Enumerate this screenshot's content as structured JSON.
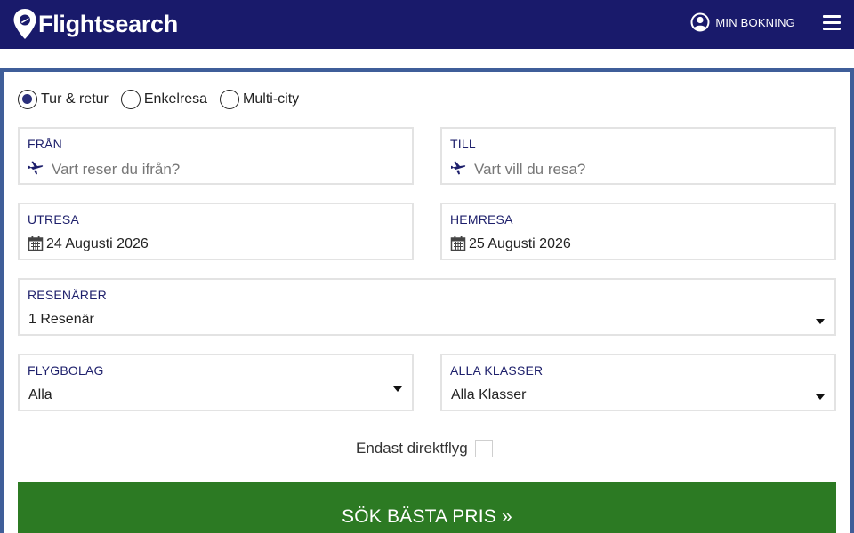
{
  "header": {
    "logo_text": "Flightsearch",
    "my_booking_label": "MIN BOKNING",
    "icons": {
      "logo": "map-pin-icon",
      "account": "user-circle-icon",
      "menu": "hamburger-icon"
    }
  },
  "trip_types": [
    {
      "label": "Tur & retur",
      "selected": true
    },
    {
      "label": "Enkelresa",
      "selected": false
    },
    {
      "label": "Multi-city",
      "selected": false
    }
  ],
  "from": {
    "label": "FRÅN",
    "placeholder": "Vart reser du ifrån?",
    "icon": "airplane-icon"
  },
  "to": {
    "label": "TILL",
    "placeholder": "Vart vill du resa?",
    "icon": "airplane-icon"
  },
  "departure": {
    "label": "UTRESA",
    "value": "24 Augusti 2026",
    "icon": "calendar-icon"
  },
  "return": {
    "label": "HEMRESA",
    "value": "25 Augusti 2026",
    "icon": "calendar-icon"
  },
  "travelers": {
    "label": "RESENÄRER",
    "value": "1 Resenär"
  },
  "airline": {
    "label": "FLYGBOLAG",
    "value": "Alla"
  },
  "cabin_class": {
    "label": "ALLA KLASSER",
    "value": "Alla Klasser"
  },
  "direct_only": {
    "label": "Endast direktflyg",
    "checked": false
  },
  "search_button": {
    "label": "SÖK BÄSTA PRIS »"
  },
  "colors": {
    "header_bg": "#191a6b",
    "panel_border": "#3f5e99",
    "field_label": "#1d1f6b",
    "search_button": "#2c7a23"
  }
}
